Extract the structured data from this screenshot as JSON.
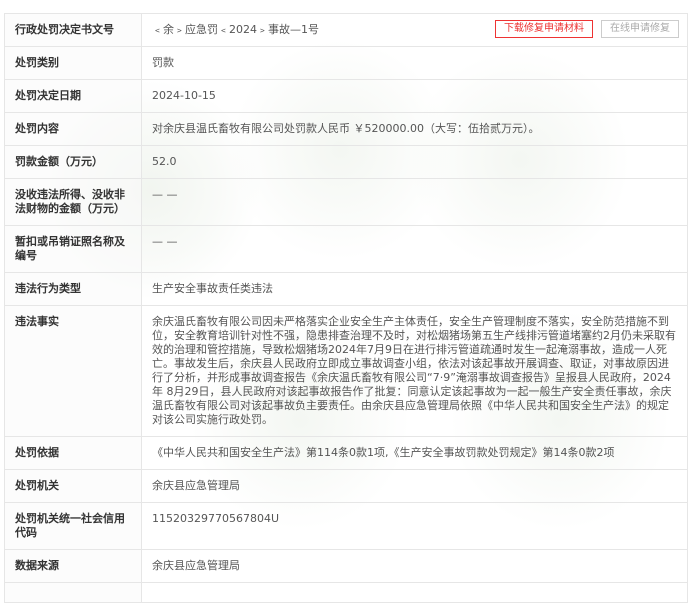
{
  "actions": {
    "download": "下载修复申请材料",
    "online": "在线申请修复"
  },
  "rows": [
    {
      "label": "行政处罚决定书文号",
      "value": "﹤余﹥应急罚﹤2024﹥事故—1号"
    },
    {
      "label": "处罚类别",
      "value": "罚款"
    },
    {
      "label": "处罚决定日期",
      "value": "2024-10-15"
    },
    {
      "label": "处罚内容",
      "value": "对余庆县温氏畜牧有限公司处罚款人民币 ￥520000.00（大写：伍拾贰万元）。"
    },
    {
      "label": "罚款金额（万元）",
      "value": "52.0"
    },
    {
      "label": "没收违法所得、没收非法财物的金额（万元）",
      "value": "— —"
    },
    {
      "label": "暂扣或吊销证照名称及编号",
      "value": "— —"
    },
    {
      "label": "违法行为类型",
      "value": "生产安全事故责任类违法"
    },
    {
      "label": "违法事实",
      "value": "余庆温氏畜牧有限公司因未严格落实企业安全生产主体责任，安全生产管理制度不落实，安全防范措施不到位，安全教育培训针对性不强，隐患排查治理不及时，对松烟猪场第五生产线排污管道堵塞约2月仍未采取有效的治理和管控措施，导致松烟猪场2024年7月9日在进行排污管道疏通时发生一起淹溺事故，造成一人死亡。事故发生后，余庆县人民政府立即成立事故调查小组，依法对该起事故开展调查、取证，对事故原因进行了分析，并形成事故调查报告《余庆温氏畜牧有限公司“7·9”淹溺事故调查报告》呈报县人民政府，2024年 8月29日，县人民政府对该起事故报告作了批复：同意认定该起事故为一起一般生产安全责任事故，余庆温氏畜牧有限公司对该起事故负主要责任。由余庆县应急管理局依照《中华人民共和国安全生产法》的规定对该公司实施行政处罚。"
    },
    {
      "label": "处罚依据",
      "value": "《中华人民共和国安全生产法》第114条0款1项,《生产安全事故罚款处罚规定》第14条0款2项"
    },
    {
      "label": "处罚机关",
      "value": "余庆县应急管理局"
    },
    {
      "label": "处罚机关统一社会信用代码",
      "value": "11520329770567804U"
    },
    {
      "label": "数据来源",
      "value": "余庆县应急管理局"
    }
  ]
}
